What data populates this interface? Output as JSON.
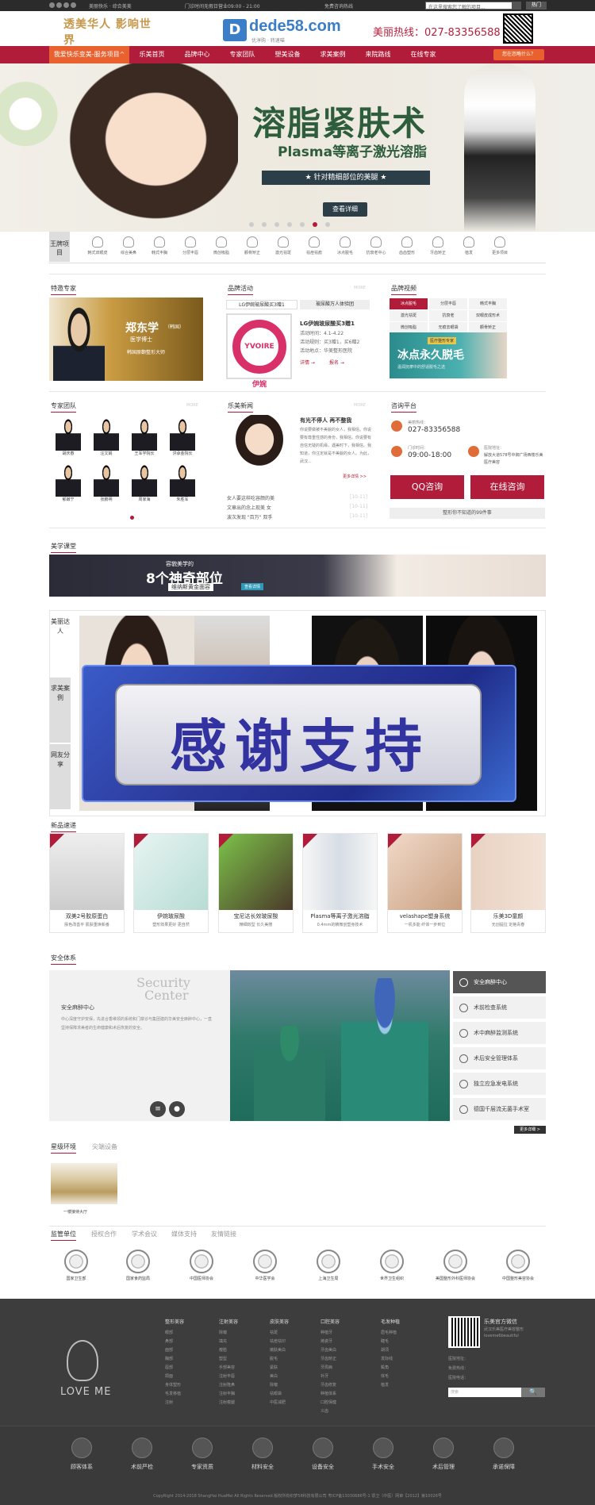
{
  "topbar": {
    "icons": [
      "social-icon-1",
      "social-icon-2",
      "social-icon-3",
      "social-icon-4"
    ],
    "tagline": "美丽快乐 · 综合美美",
    "hours": "门诊时间无假日营业09:00 - 21:00",
    "free_consult": "免费咨询热线",
    "search_placeholder": "在这里搜索您了解的项目...",
    "login": "热门"
  },
  "header": {
    "logo_left": "透美华人 影响世界",
    "logo_brand": "dede58.com",
    "logo_slogan": "优淳购 · 转速喵",
    "hotline": "美丽热线：027-83356588"
  },
  "nav": {
    "items": [
      "我爱快乐变美-服务项目^",
      "乐美首页",
      "品牌中心",
      "专家团队",
      "塑美设备",
      "求美案例",
      "来院路线",
      "在线专家"
    ],
    "cta": "您在忽略什么？"
  },
  "banner": {
    "title": "溶脂紧肤术",
    "subtitle": "Plasma等离子激光溶脂",
    "ribbon": "★ 针对精细部位的美腿 ★",
    "button": "查看详细"
  },
  "categories": {
    "label": "王牌项目",
    "items": [
      "韩式双眼皮",
      "综合美鼻",
      "韩式丰胸",
      "分层丰唇",
      "微创吸脂",
      "颧骨矫正",
      "激光祛斑",
      "祛痘祛痕",
      "冰点脱毛",
      "抗衰老中心",
      "齿齿塑形",
      "牙齿矫正",
      "植发",
      "更多项目"
    ]
  },
  "expert": {
    "title": "特邀专家",
    "name": "郑东学",
    "country": "（韩国）",
    "role": "医学博士",
    "desc": "韩国原颧整形大师"
  },
  "activity": {
    "title": "品牌活动",
    "more": "MORE",
    "tabs": [
      "LG伊婉玻尿酸买3赠1",
      "玻尿酸万人体验团"
    ],
    "logo": "YVOIRE 伊婉",
    "headline": "LG伊婉玻尿酸买3赠1",
    "lines": [
      "活动时间：4.1-4.22",
      "活动规则：买3赠1，买6赠2",
      "活动地点：华美整形医院"
    ],
    "link1": "详情 →",
    "link2": "报名 →"
  },
  "brand_video": {
    "title": "品牌视频",
    "cells": [
      "冰点脱毛",
      "分层丰唇",
      "韩式丰胸",
      "激光祛斑",
      "抗衰老",
      "双眼皮成形术",
      "微创吸脂",
      "无痕去眼袋",
      "颧骨矫正"
    ],
    "banner_tag": "医疗整形专家",
    "banner_title": "冰点永久脱毛",
    "banner_sub": "温润抚摩中的舒适脱毛之选"
  },
  "team": {
    "title": "专家团队",
    "more": "MORE",
    "doctors": [
      "胡庆春",
      "汪文娟",
      "王军学院长",
      "洪承金院长",
      "郁嫩宁",
      "张鹏明",
      "周家海",
      "朱胜军"
    ]
  },
  "news": {
    "title": "乐美新闻",
    "more": "MORE",
    "headline": "有光不停人 再不整我",
    "summary": "你说要做被不美貌的女人，我相信。你说要有尊重性感的身份，我相信。你说要有自信无疑的机缘，遇美时下，我相信。我知道，你注定就是不美貌的女人。为此，武汉...",
    "link": "更多详情 >>",
    "items": [
      {
        "text": "女人要这样吃容颜的美",
        "date": "[10-11]"
      },
      {
        "text": "文章出的念上现美 女",
        "date": "[10-11]"
      },
      {
        "text": "波次发现 \"百万\" 双手",
        "date": "[10-11]"
      }
    ]
  },
  "consult": {
    "title": "咨询平台",
    "phone_label": "美丽热线：",
    "phone": "027-83356588",
    "hours_label": "门诊时间：",
    "hours": "09:00-18:00",
    "addr_label": "医院地址：",
    "addr": "解放大道578号中御广场西楼乐美医疗美容",
    "qq": "QQ咨询",
    "online": "在线咨询",
    "footer": "整形你不知道的99件事"
  },
  "beauty_class": {
    "title": "美学课堂",
    "pre": "容貌美学的",
    "big": "8个神奇部位",
    "sub": "维纳斯黄金面容",
    "button": "查看详情"
  },
  "gallery": {
    "tabs": [
      "美丽达人",
      "求美案例",
      "网友分享"
    ]
  },
  "overlay": {
    "text": "感谢支持"
  },
  "products": {
    "title": "新品速递",
    "items": [
      {
        "name": "双美2号胶原蛋白",
        "desc": "肤色改善平 肌肤重焕新番"
      },
      {
        "name": "伊婉玻尿酸",
        "desc": "塑形效果更好 更自然"
      },
      {
        "name": "宝尼达长效玻尿酸",
        "desc": "精细效型 长久美丽"
      },
      {
        "name": "Plasma等离子激光溶脂",
        "desc": "0.4mm的精微创塑身技术"
      },
      {
        "name": "velashape塑身系统",
        "desc": "一机多能 纤体一步到位"
      },
      {
        "name": "乐美3D童颜",
        "desc": "无创提拉 定格青春"
      }
    ]
  },
  "safety": {
    "title": "安全体系",
    "logo1": "Security",
    "logo2": "Center",
    "heading": "安全麻醉中心",
    "paragraph": "中心深度守护安保，先进合香维领的系统和门禁诊与集团建的华美安全麻醉中心，一直坚持保障求美者的生命健康和术后恢复的安全。",
    "items": [
      "安全麻醉中心",
      "术前检查系统",
      "术中麻醉监测系统",
      "术后安全管理体系",
      "独立应急发电系统",
      "德国千层流无菌手术室"
    ],
    "more": "更多详细 >"
  },
  "environment": {
    "tabs": [
      "星级环境",
      "尖端设备"
    ],
    "caption": "一楼接待大厅"
  },
  "supervision": {
    "tabs": [
      "监管单位",
      "授权合作",
      "学术会议",
      "媒体支持",
      "友情链接"
    ],
    "items": [
      "国家卫生部",
      "国家食药监局",
      "中国医师协会",
      "中华医学会",
      "上海卫生局",
      "世界卫生组织",
      "美国整形外科医师协会",
      "中国整形美容协会"
    ]
  },
  "footer": {
    "logo": "LOVE ME",
    "columns": [
      {
        "title": "整形美容",
        "links": [
          "眼部",
          "鼻部",
          "面部",
          "胸部",
          "唇部",
          "颌面",
          "身体塑形",
          "毛发移植",
          "注射"
        ]
      },
      {
        "title": "注射美容",
        "links": [
          "除皱",
          "填充",
          "瘦脸",
          "塑型",
          "手部美容",
          "注射丰唇",
          "注射隆鼻",
          "注射丰胸",
          "注射瘦腿"
        ]
      },
      {
        "title": "皮肤美容",
        "links": [
          "祛斑",
          "祛痘祛印",
          "嫩肤美白",
          "脱毛",
          "紧肤",
          "美白",
          "除皱",
          "祛眼袋",
          "中医减肥"
        ]
      },
      {
        "title": "口腔美容",
        "links": [
          "种植牙",
          "烤瓷牙",
          "牙齿美白",
          "牙齿矫正",
          "牙周病",
          "补牙",
          "牙齿修复",
          "种植体系",
          "口腔保健",
          "义齿"
        ]
      },
      {
        "title": "毛发种植",
        "links": [
          "眉毛种植",
          "睫毛",
          "胡须",
          "发际线",
          "鬓角",
          "体毛",
          "植发"
        ]
      }
    ],
    "wechat_title": "乐美官方微信",
    "wechat_line1": "武汉乐美医疗美容整形",
    "wechat_line2": "loveme6beautiful",
    "contacts": [
      "医院地址：",
      "免费热线：",
      "医院电话："
    ],
    "search_placeholder": "搜索",
    "search_btn": "🔍",
    "bar": [
      "顾客体系",
      "术前严检",
      "专家资质",
      "材料安全",
      "设备安全",
      "手术安全",
      "术后管理",
      "承诺保障"
    ],
    "copyright": "CopyRight 2014-2018 ShangHai HuaMei All Rights Reserved    版权所有织梦58科技有限公司    粤ICP备13030686号-1    鄂卫（中医）网审【2012】第10026号"
  }
}
